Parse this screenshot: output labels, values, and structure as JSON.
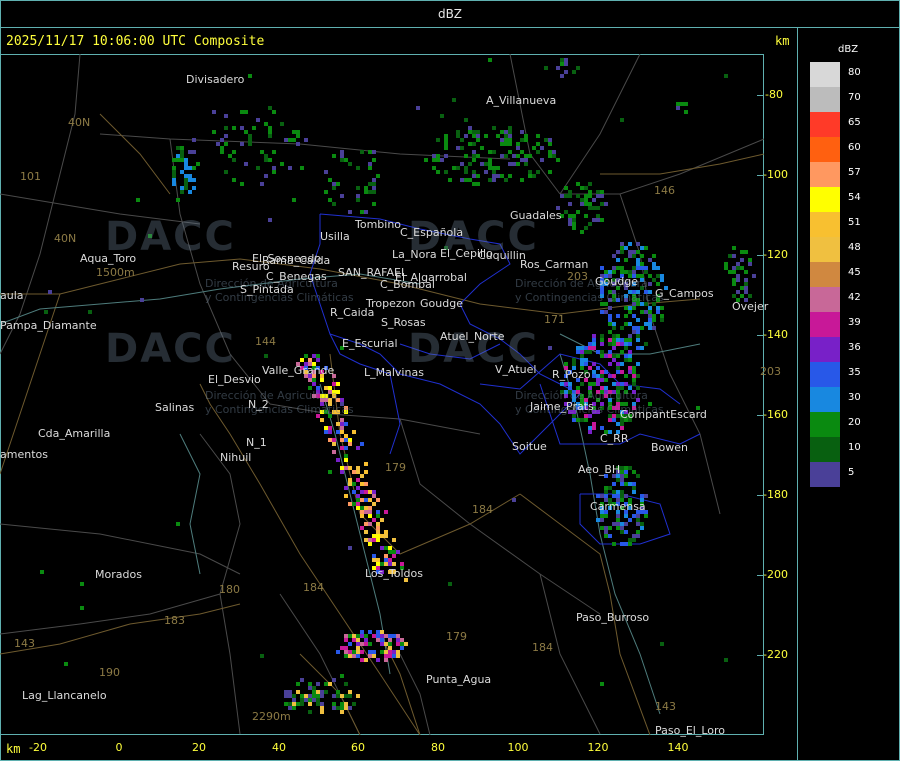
{
  "window_title": "dBZ",
  "header": "2025/11/17 10:06:00 UTC Composite",
  "units": {
    "top": "km",
    "bottom": "km"
  },
  "axes": {
    "y_ticks": [
      "-80",
      "-100",
      "-120",
      "-140",
      "-160",
      "-180",
      "-200",
      "-220"
    ],
    "x_ticks": [
      "-20",
      "0",
      "20",
      "40",
      "60",
      "80",
      "100",
      "120",
      "140"
    ]
  },
  "legend": {
    "title": "dBZ",
    "entries": [
      {
        "label": "80",
        "color": "#d8d8d8"
      },
      {
        "label": "70",
        "color": "#bcbcbc"
      },
      {
        "label": "65",
        "color": "#ff3a28"
      },
      {
        "label": "60",
        "color": "#ff6010"
      },
      {
        "label": "57",
        "color": "#ff9860"
      },
      {
        "label": "54",
        "color": "#ffff00"
      },
      {
        "label": "51",
        "color": "#f8c030"
      },
      {
        "label": "48",
        "color": "#f0c040"
      },
      {
        "label": "45",
        "color": "#d08840"
      },
      {
        "label": "42",
        "color": "#c86898"
      },
      {
        "label": "39",
        "color": "#c81898"
      },
      {
        "label": "36",
        "color": "#7820c8"
      },
      {
        "label": "35",
        "color": "#2858e8"
      },
      {
        "label": "30",
        "color": "#1888e0"
      },
      {
        "label": "20",
        "color": "#0a8a10"
      },
      {
        "label": "10",
        "color": "#086010"
      },
      {
        "label": "5",
        "color": "#4a4098"
      }
    ]
  },
  "places": [
    {
      "name": "Divisadero"
    },
    {
      "name": "A_Villanueva"
    },
    {
      "name": "Guadales"
    },
    {
      "name": "C_Española"
    },
    {
      "name": "Tombino"
    },
    {
      "name": "Usilla"
    },
    {
      "name": "La_Nora"
    },
    {
      "name": "El_Cepillo"
    },
    {
      "name": "Cuquillin"
    },
    {
      "name": "Rama_Caída"
    },
    {
      "name": "El_Sosneado"
    },
    {
      "name": "Resuro"
    },
    {
      "name": "C_Benegas"
    },
    {
      "name": "SAN_RAFAEL"
    },
    {
      "name": "S_Pintada"
    },
    {
      "name": "El_Algarrobal"
    },
    {
      "name": "C_Bombal"
    },
    {
      "name": "Tropezon"
    },
    {
      "name": "Goudge"
    },
    {
      "name": "R_Caida"
    },
    {
      "name": "S_Rosas"
    },
    {
      "name": "Atuel_Norte"
    },
    {
      "name": "E_Escurial"
    },
    {
      "name": "Valle_Grande"
    },
    {
      "name": "L_Malvinas"
    },
    {
      "name": "El_Desvio"
    },
    {
      "name": "N_2"
    },
    {
      "name": "N_1"
    },
    {
      "name": "Nihuil"
    },
    {
      "name": "Salinas"
    },
    {
      "name": "Cda_Amarilla"
    },
    {
      "name": "amentos"
    },
    {
      "name": "Aqua_Toro"
    },
    {
      "name": "aula"
    },
    {
      "name": "Pampa_Diamante"
    },
    {
      "name": "Morados"
    },
    {
      "name": "Lag_Llancanelo"
    },
    {
      "name": "Los_Toldos"
    },
    {
      "name": "Punta_Agua"
    },
    {
      "name": "V_Atuel"
    },
    {
      "name": "R_Pozo"
    },
    {
      "name": "Jaime_Prats"
    },
    {
      "name": "Soitue"
    },
    {
      "name": "Goudge"
    },
    {
      "name": "G_Campos"
    },
    {
      "name": "Ovejer"
    },
    {
      "name": "CompantEscard"
    },
    {
      "name": "Bowen"
    },
    {
      "name": "C_RR"
    },
    {
      "name": "Aeo_BH"
    },
    {
      "name": "Carmensa"
    },
    {
      "name": "Paso_Burroso"
    },
    {
      "name": "Paso_El_Loro"
    },
    {
      "name": "Ros_Carman"
    }
  ],
  "routes": [
    "40N",
    "40N",
    "101",
    "146",
    "143",
    "144",
    "171",
    "203",
    "179",
    "184",
    "180",
    "184",
    "183",
    "190",
    "184",
    "179",
    "143",
    "203"
  ],
  "elevations": [
    "1500m",
    "2290m"
  ],
  "watermark": {
    "brand": "DACC",
    "line1": "Dirección de Agricultura",
    "line2": "y Contingencias Climáticas"
  }
}
